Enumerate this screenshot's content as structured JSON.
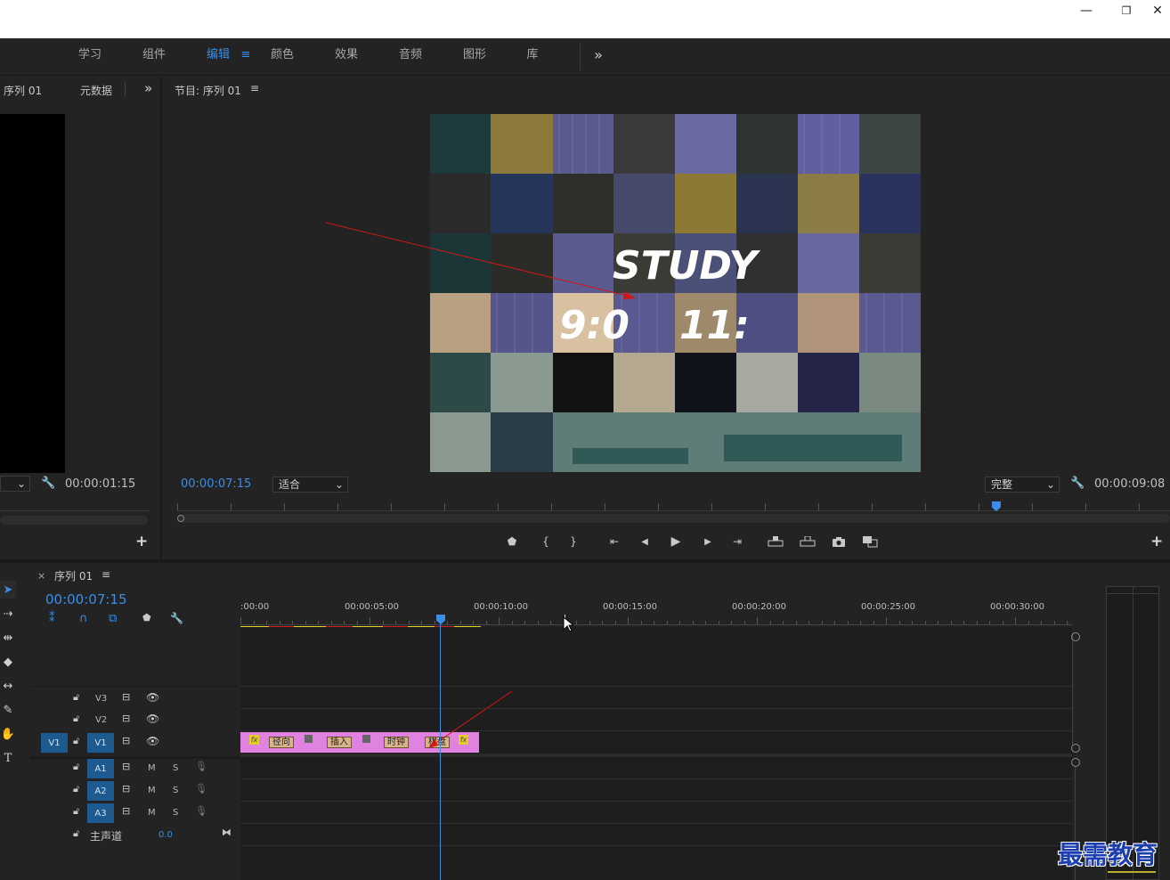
{
  "window": {
    "minimize_glyph": "—",
    "restore_glyph": "❐",
    "close_glyph": "✕"
  },
  "workspaces": {
    "items": [
      {
        "label": "学习"
      },
      {
        "label": "组件"
      },
      {
        "label": "编辑"
      },
      {
        "label": "颜色"
      },
      {
        "label": "效果"
      },
      {
        "label": "音频"
      },
      {
        "label": "图形"
      },
      {
        "label": "库"
      }
    ],
    "active": "编辑",
    "menu_glyph": "≡",
    "more_glyph": "»"
  },
  "source_panel": {
    "tab_sequence": "序列 01",
    "tab_metadata": "元数据",
    "more_glyph": "»",
    "timecode": "00:00:01:15",
    "add_glyph": "+"
  },
  "program_panel": {
    "tab_title": "节目: 序列 01",
    "menu_glyph": "≡",
    "current_timecode": "00:00:07:15",
    "fit_select": "适合",
    "quality_select": "完整",
    "duration_timecode": "00:00:09:08",
    "playhead_fraction": 0.825,
    "overlay_text_1": "STUDY",
    "overlay_text_2": "9:0",
    "overlay_text_3": "11:"
  },
  "transport": {
    "add_marker": "⬟",
    "mark_in": "{",
    "mark_out": "}",
    "go_to_in": "⇤",
    "step_back": "◀",
    "play": "▶",
    "step_forward": "▶",
    "go_to_out": "⇥",
    "add_glyph": "+"
  },
  "timeline": {
    "close_glyph": "×",
    "tab_title": "序列 01",
    "menu_glyph": "≡",
    "timecode": "00:00:07:15",
    "ruler_labels": [
      ":00:00",
      "00:00:05:00",
      "00:00:10:00",
      "00:00:15:00",
      "00:00:20:00",
      "00:00:25:00",
      "00:00:30:00"
    ],
    "tracks_video": [
      {
        "name": "V3"
      },
      {
        "name": "V2"
      },
      {
        "name": "V1",
        "source": "V1"
      }
    ],
    "tracks_audio": [
      {
        "name": "A1",
        "m": "M",
        "s": "S"
      },
      {
        "name": "A2",
        "m": "M",
        "s": "S"
      },
      {
        "name": "A3",
        "m": "M",
        "s": "S"
      }
    ],
    "master": {
      "label": "主声道",
      "value": "0.0"
    },
    "clip": {
      "color": "#e083e0",
      "transitions": [
        "径向",
        "插入",
        "时钟",
        "棋盘"
      ],
      "fx_label": "fx"
    }
  },
  "colors": {
    "accent": "#3a8ee6",
    "clip": "#e083e0",
    "watermark": "#1d3fae"
  },
  "watermark": "最需教育"
}
